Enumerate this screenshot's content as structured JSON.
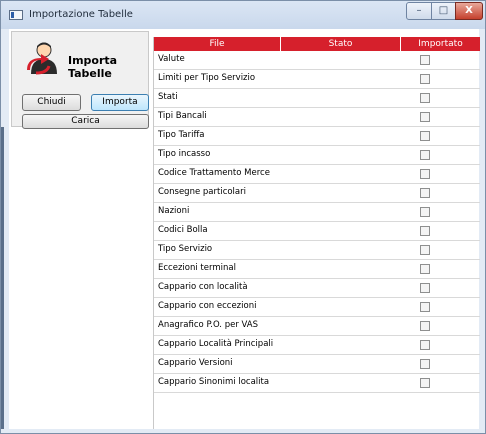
{
  "window": {
    "title": "Importazione Tabelle"
  },
  "panel": {
    "title": "Importa Tabelle",
    "buttons": {
      "close": "Chiudi",
      "import": "Importa",
      "load": "Carica"
    }
  },
  "grid": {
    "columns": [
      "File",
      "Stato",
      "Importato"
    ],
    "rows": [
      {
        "file": "Valute",
        "stato": "",
        "importato": false
      },
      {
        "file": "Limiti per Tipo Servizio",
        "stato": "",
        "importato": false
      },
      {
        "file": "Stati",
        "stato": "",
        "importato": false
      },
      {
        "file": "Tipi Bancali",
        "stato": "",
        "importato": false
      },
      {
        "file": "Tipo Tariffa",
        "stato": "",
        "importato": false
      },
      {
        "file": "Tipo incasso",
        "stato": "",
        "importato": false
      },
      {
        "file": "Codice Trattamento Merce",
        "stato": "",
        "importato": false
      },
      {
        "file": "Consegne particolari",
        "stato": "",
        "importato": false
      },
      {
        "file": "Nazioni",
        "stato": "",
        "importato": false
      },
      {
        "file": "Codici Bolla",
        "stato": "",
        "importato": false
      },
      {
        "file": "Tipo Servizio",
        "stato": "",
        "importato": false
      },
      {
        "file": "Eccezioni terminal",
        "stato": "",
        "importato": false
      },
      {
        "file": "Cappario  con località",
        "stato": "",
        "importato": false
      },
      {
        "file": "Cappario con eccezioni",
        "stato": "",
        "importato": false
      },
      {
        "file": "Anagrafico P.O. per VAS",
        "stato": "",
        "importato": false
      },
      {
        "file": "Cappario Località Principali",
        "stato": "",
        "importato": false
      },
      {
        "file": "Cappario Versioni",
        "stato": "",
        "importato": false
      },
      {
        "file": "Cappario Sinonimi localita",
        "stato": "",
        "importato": false
      }
    ]
  },
  "colors": {
    "header": "#d6202c",
    "accent_button": "#bee6fd"
  },
  "icons": [
    "app-window-icon",
    "user-import-icon",
    "minimize-icon",
    "maximize-icon",
    "close-icon"
  ]
}
